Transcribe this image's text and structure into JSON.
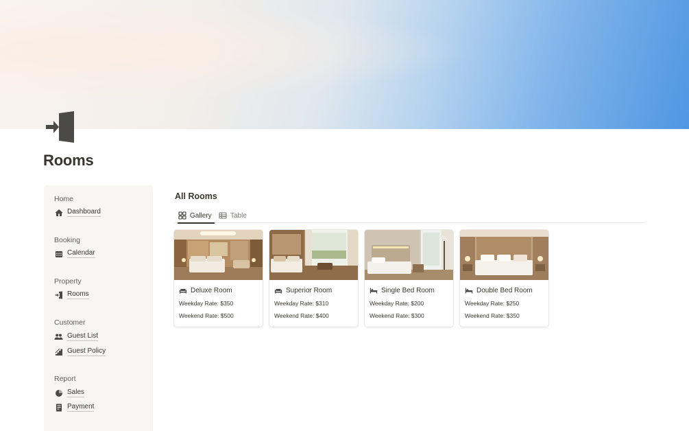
{
  "page": {
    "title": "Rooms",
    "icon": "door-enter-icon"
  },
  "sidebar": {
    "sections": [
      {
        "head": "Home",
        "items": [
          {
            "label": "Dashboard",
            "icon": "home-icon"
          }
        ]
      },
      {
        "head": "Booking",
        "items": [
          {
            "label": "Calendar",
            "icon": "calendar-icon"
          }
        ]
      },
      {
        "head": "Property",
        "items": [
          {
            "label": "Rooms",
            "icon": "door-enter-icon"
          }
        ]
      },
      {
        "head": "Customer",
        "items": [
          {
            "label": "Guest List",
            "icon": "people-icon"
          },
          {
            "label": "Guest Policy",
            "icon": "stairs-icon"
          }
        ]
      },
      {
        "head": "Report",
        "items": [
          {
            "label": "Sales",
            "icon": "pie-chart-icon"
          },
          {
            "label": "Payment",
            "icon": "receipt-icon"
          }
        ]
      }
    ]
  },
  "main": {
    "title": "All Rooms",
    "tabs": [
      {
        "label": "Gallery",
        "icon": "gallery-icon",
        "active": true
      },
      {
        "label": "Table",
        "icon": "table-icon",
        "active": false
      }
    ],
    "cards": [
      {
        "name": "Deluxe Room",
        "icon": "sofa-icon",
        "weekday": "Weekday Rate: $350",
        "weekend": "Weekend Rate: $500"
      },
      {
        "name": "Superior Room",
        "icon": "sofa-icon",
        "weekday": "Weekday Rate: $310",
        "weekend": "Weekend Rate: $400"
      },
      {
        "name": "Single Bed Room",
        "icon": "bed-icon",
        "weekday": "Weekday Rate: $200",
        "weekend": "Weekend Rate: $300"
      },
      {
        "name": "Double Bed Room",
        "icon": "bed-icon",
        "weekday": "Weekday Rate: $250",
        "weekend": "Weekend Rate: $350"
      }
    ]
  },
  "colors": {
    "text": "#37352f",
    "muted": "#787774",
    "sidebar_bg": "#f7f6f3",
    "cover_blue": "#4f96e2"
  }
}
